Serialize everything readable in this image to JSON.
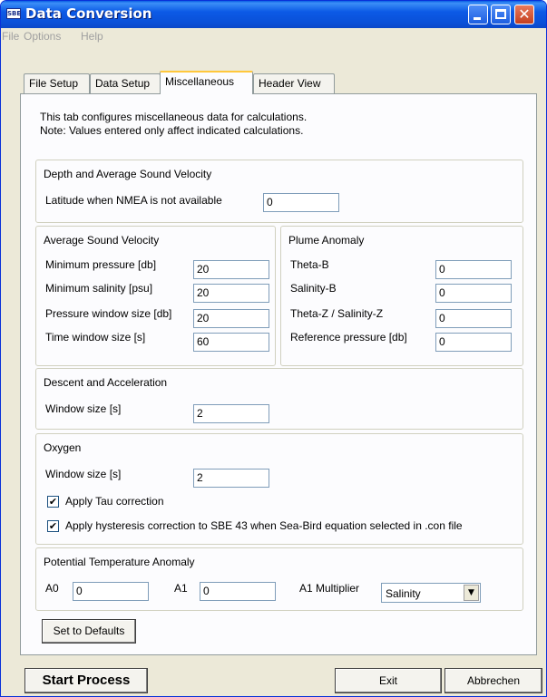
{
  "window": {
    "title": "Data Conversion",
    "app_icon_text": "SBE"
  },
  "menu": [
    "File",
    "Options",
    "Help"
  ],
  "tabs": [
    "File Setup",
    "Data Setup",
    "Miscellaneous",
    "Header View"
  ],
  "active_tab": "Miscellaneous",
  "intro": {
    "line1": "This tab configures miscellaneous data for calculations.",
    "line2": "Note: Values entered only affect indicated calculations."
  },
  "depth_group": {
    "title": "Depth and Average Sound Velocity",
    "latitude_label": "Latitude when NMEA is not available",
    "latitude_value": "0"
  },
  "avg_sound_group": {
    "title": "Average Sound Velocity",
    "fields": [
      {
        "label": "Minimum pressure [db]",
        "value": "20"
      },
      {
        "label": "Minimum salinity [psu]",
        "value": "20"
      },
      {
        "label": "Pressure window size [db]",
        "value": "20"
      },
      {
        "label": "Time window size [s]",
        "value": "60"
      }
    ]
  },
  "plume_group": {
    "title": "Plume Anomaly",
    "fields": [
      {
        "label": "Theta-B",
        "value": "0"
      },
      {
        "label": "Salinity-B",
        "value": "0"
      },
      {
        "label": "Theta-Z / Salinity-Z",
        "value": "0"
      },
      {
        "label": "Reference pressure [db]",
        "value": "0"
      }
    ]
  },
  "descent_group": {
    "title": "Descent and Acceleration",
    "window_label": "Window size [s]",
    "window_value": "2"
  },
  "oxygen_group": {
    "title": "Oxygen",
    "window_label": "Window size [s]",
    "window_value": "2",
    "tau_label": "Apply Tau correction",
    "tau_checked": true,
    "hysteresis_label": "Apply hysteresis correction to SBE 43 when Sea-Bird equation selected in .con file",
    "hysteresis_checked": true,
    "check_glyph": "✔"
  },
  "pta_group": {
    "title": "Potential Temperature Anomaly",
    "a0_label": "A0",
    "a0_value": "0",
    "a1_label": "A1",
    "a1_value": "0",
    "mult_label": "A1 Multiplier",
    "mult_value": "Salinity"
  },
  "buttons": {
    "defaults": "Set to Defaults",
    "start": "Start Process",
    "exit": "Exit",
    "cancel": "Abbrechen"
  }
}
